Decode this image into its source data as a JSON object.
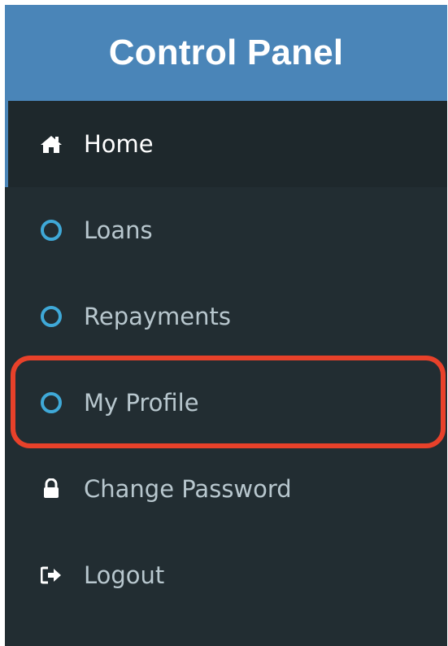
{
  "header": {
    "title": "Control Panel"
  },
  "menu": {
    "items": [
      {
        "label": "Home",
        "icon": "home-icon",
        "active": true
      },
      {
        "label": "Loans",
        "icon": "circle-outline-icon"
      },
      {
        "label": "Repayments",
        "icon": "circle-outline-icon"
      },
      {
        "label": "My Profile",
        "icon": "circle-outline-icon",
        "highlighted": true
      },
      {
        "label": "Change Password",
        "icon": "lock-icon"
      },
      {
        "label": "Logout",
        "icon": "sign-out-icon"
      }
    ]
  },
  "colors": {
    "header_bg": "#4a85b8",
    "sidebar_bg": "#222d32",
    "active_bg": "#1e282c",
    "circle_accent": "#3fa9d8",
    "highlight_outline": "#e8412a",
    "text_muted": "#b8c7ce"
  }
}
